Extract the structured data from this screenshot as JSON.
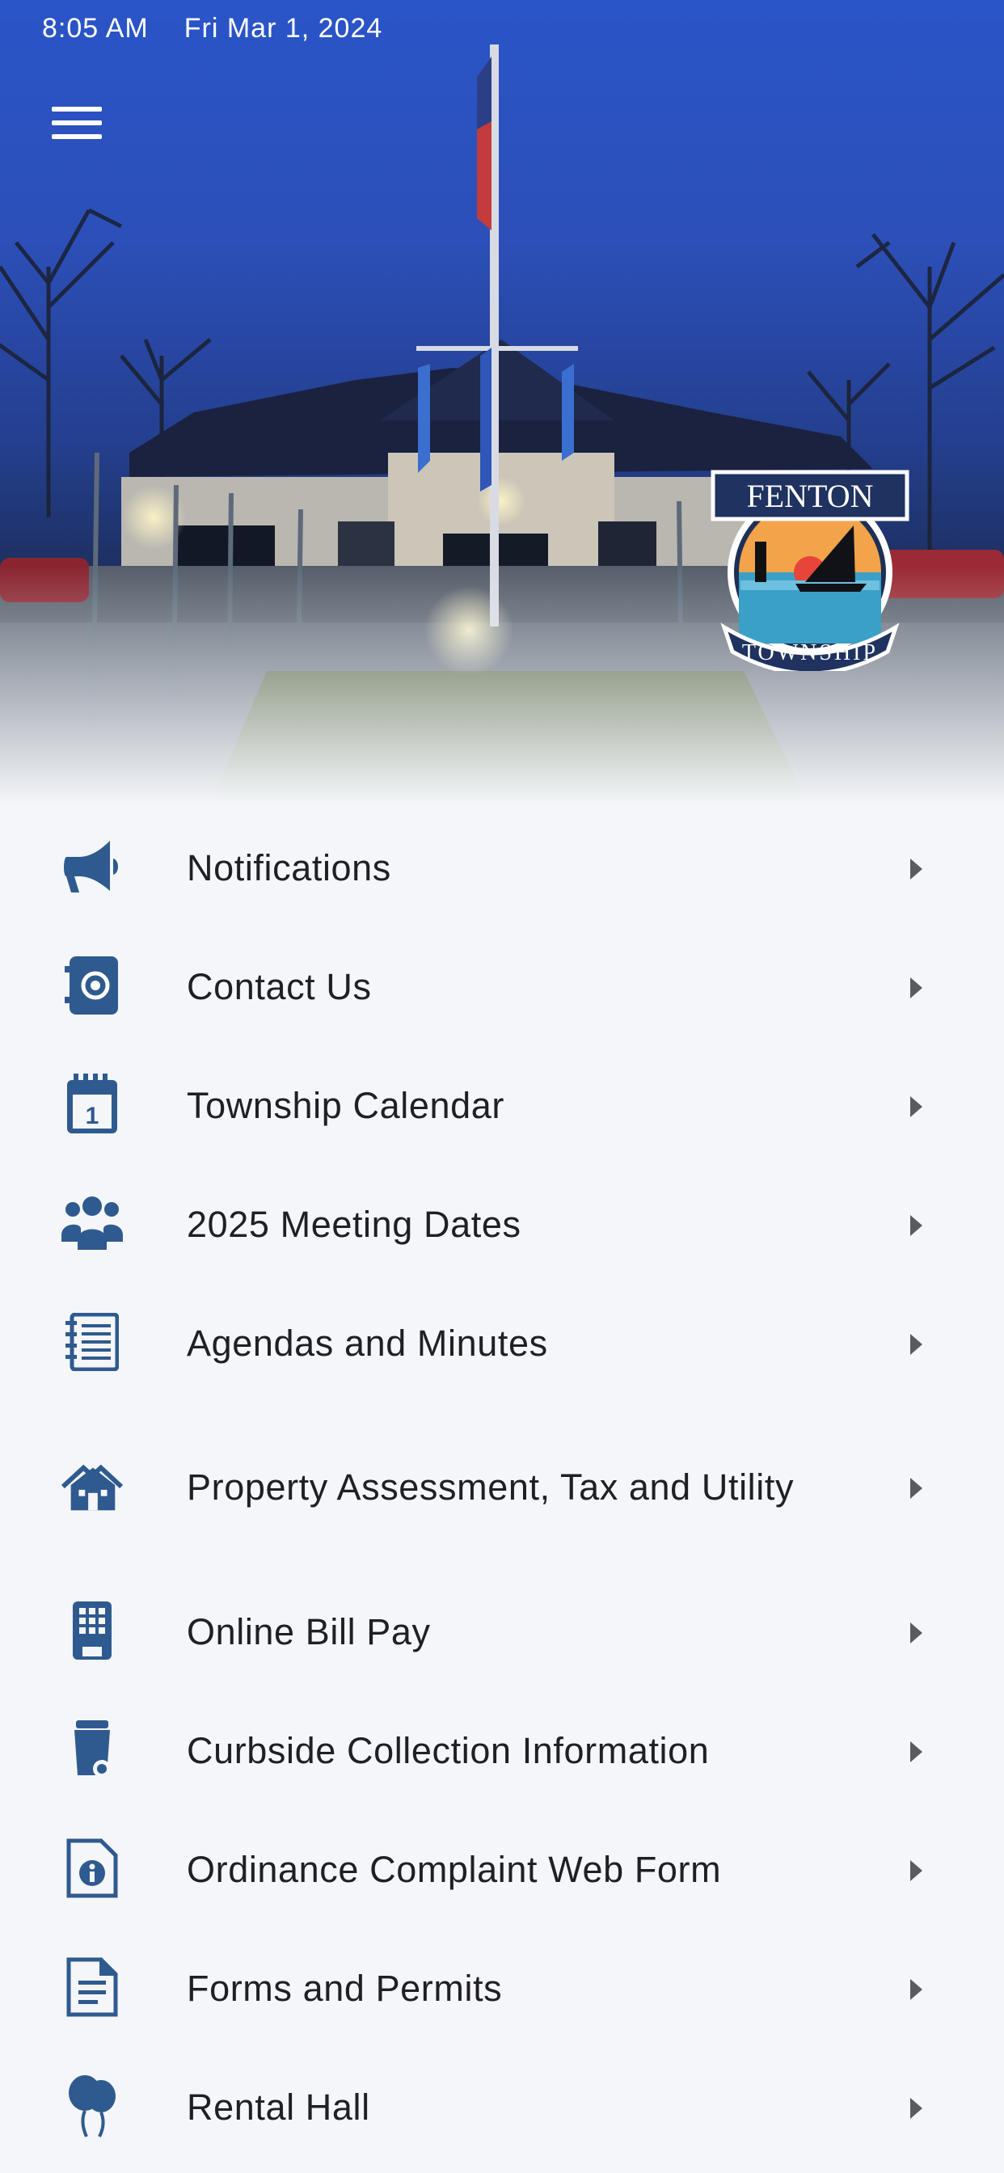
{
  "status_bar": {
    "time": "8:05 AM",
    "date": "Fri Mar 1, 2024"
  },
  "header": {
    "menu_icon": "hamburger-icon"
  },
  "logo": {
    "top_text": "FENTON",
    "bottom_text": "TOWNSHIP"
  },
  "colors": {
    "icon": "#2f5a8f",
    "text": "#1f1f24",
    "chevron": "#5b5b5f",
    "background": "#f4f6f9"
  },
  "menu": [
    {
      "label": "Notifications",
      "icon": "megaphone-icon"
    },
    {
      "label": "Contact Us",
      "icon": "address-book-icon"
    },
    {
      "label": "Township Calendar",
      "icon": "calendar-icon"
    },
    {
      "label": "2025 Meeting Dates",
      "icon": "users-group-icon"
    },
    {
      "label": "Agendas and Minutes",
      "icon": "notebook-icon"
    },
    {
      "label": "Property Assessment, Tax and Utility",
      "icon": "houses-icon"
    },
    {
      "label": "Online Bill Pay",
      "icon": "keypad-icon"
    },
    {
      "label": "Curbside Collection Information",
      "icon": "trash-bin-icon"
    },
    {
      "label": "Ordinance Complaint Web Form",
      "icon": "info-document-icon"
    },
    {
      "label": "Forms and Permits",
      "icon": "document-icon"
    },
    {
      "label": "Rental Hall",
      "icon": "balloons-icon"
    }
  ]
}
